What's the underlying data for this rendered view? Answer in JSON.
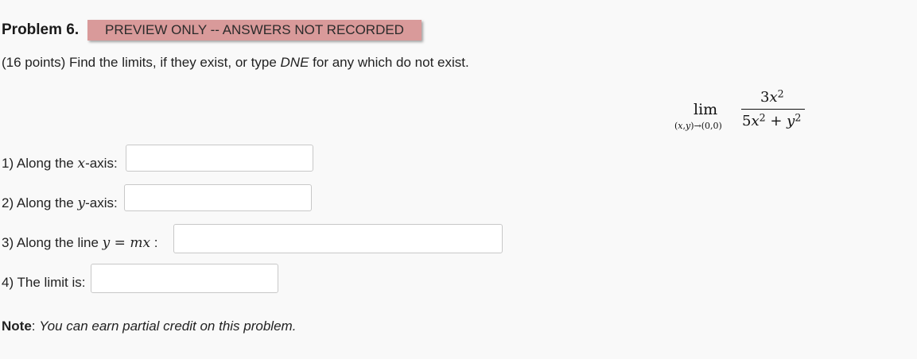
{
  "problem": {
    "title": "Problem 6.",
    "preview_badge": "PREVIEW ONLY -- ANSWERS NOT RECORDED",
    "instructions_prefix": "(16 points) Find the limits, if they exist, or type ",
    "instructions_dne": "DNE",
    "instructions_suffix": " for any which do not exist."
  },
  "formula": {
    "lim": "lim",
    "subscript": "(x,y)→(0,0)",
    "numerator": "3x²",
    "denominator": "5x² + y²"
  },
  "questions": [
    {
      "prefix": "1) Along the ",
      "var": "x",
      "suffix": "-axis:",
      "value": ""
    },
    {
      "prefix": "2) Along the ",
      "var": "y",
      "suffix": "-axis:",
      "value": ""
    },
    {
      "prefix": "3) Along the line ",
      "math": "y = mx",
      "suffix": " :",
      "value": ""
    },
    {
      "prefix": "4) The limit is:",
      "value": ""
    }
  ],
  "note": {
    "label": "Note",
    "separator": ": ",
    "text": "You can earn partial credit on this problem."
  }
}
